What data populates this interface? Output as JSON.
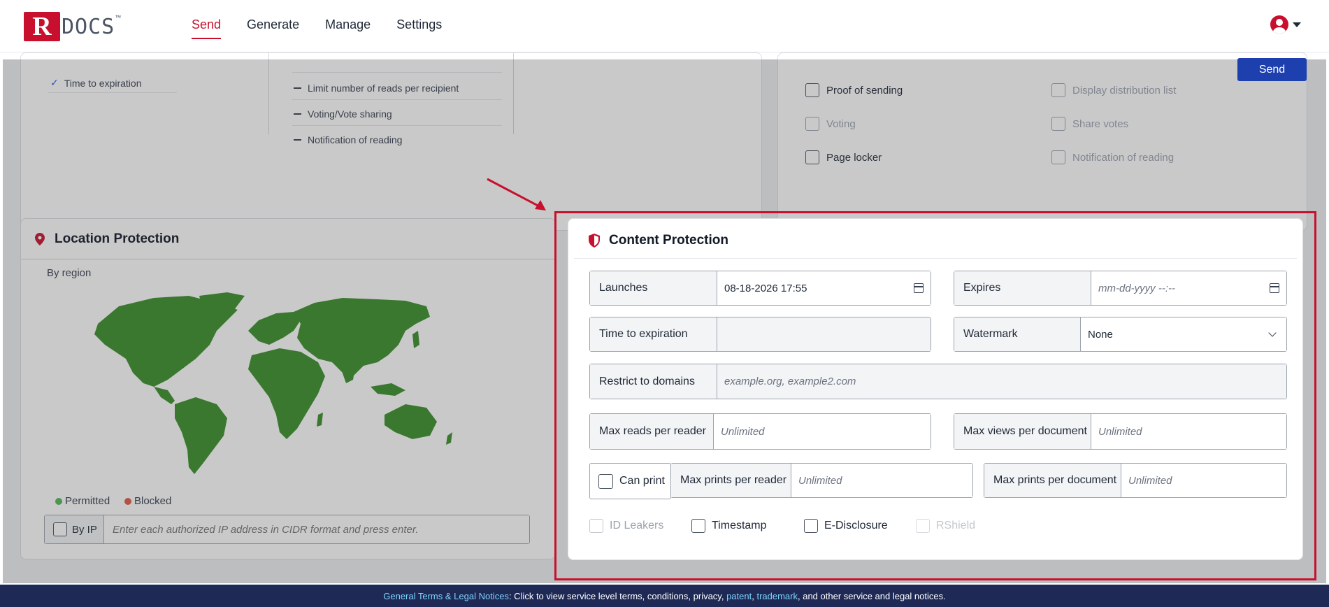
{
  "logo": {
    "letter": "R",
    "text": "DOCS",
    "tm": "™"
  },
  "nav": {
    "items": [
      {
        "label": "Send",
        "active": true
      },
      {
        "label": "Generate",
        "active": false
      },
      {
        "label": "Manage",
        "active": false
      },
      {
        "label": "Settings",
        "active": false
      }
    ]
  },
  "toolbar": {
    "send_label": "Send"
  },
  "features_card": {
    "checked_item": "Time to expiration",
    "items": [
      "Limit number of reads per recipient",
      "Voting/Vote sharing",
      "Notification of reading"
    ]
  },
  "options_card": {
    "left": [
      {
        "label": "Proof of sending",
        "enabled": true
      },
      {
        "label": "Voting",
        "enabled": false
      },
      {
        "label": "Page locker",
        "enabled": true
      }
    ],
    "right": [
      {
        "label": "Display distribution list",
        "enabled": false
      },
      {
        "label": "Share votes",
        "enabled": false
      },
      {
        "label": "Notification of reading",
        "enabled": false
      }
    ]
  },
  "location": {
    "title": "Location Protection",
    "by_region_label": "By region",
    "legend": {
      "permitted": "Permitted",
      "blocked": "Blocked",
      "permitted_color": "#3a8f2a",
      "blocked_color": "#c0504d"
    },
    "ip": {
      "label": "By IP",
      "placeholder": "Enter each authorized IP address in CIDR format and press enter."
    }
  },
  "content": {
    "title": "Content Protection",
    "launches": {
      "label": "Launches",
      "value": "08-18-2026 17:55"
    },
    "expires": {
      "label": "Expires",
      "placeholder": "mm-dd-yyyy --:--"
    },
    "time_to_expiration": {
      "label": "Time to expiration",
      "value": ""
    },
    "watermark": {
      "label": "Watermark",
      "value": "None"
    },
    "restrict_domains": {
      "label": "Restrict to domains",
      "placeholder": "example.org, example2.com"
    },
    "max_reads_reader": {
      "label": "Max reads per reader",
      "placeholder": "Unlimited"
    },
    "max_views_document": {
      "label": "Max views per document",
      "placeholder": "Unlimited"
    },
    "can_print": {
      "label": "Can print"
    },
    "max_prints_reader": {
      "label": "Max prints per reader",
      "placeholder": "Unlimited"
    },
    "max_prints_document": {
      "label": "Max prints per document",
      "placeholder": "Unlimited"
    },
    "bottom_options": [
      {
        "label": "ID Leakers",
        "enabled": false
      },
      {
        "label": "Timestamp",
        "enabled": true
      },
      {
        "label": "E-Disclosure",
        "enabled": true
      },
      {
        "label": "RShield",
        "enabled": false
      }
    ]
  },
  "footer": {
    "terms_link": "General Terms & Legal Notices",
    "text_before": ": Click to view service level terms, conditions, privacy, ",
    "patent_link": "patent",
    "separator": ", ",
    "trademark_link": "trademark",
    "text_after": ", and other service and legal notices."
  },
  "colors": {
    "brand_red": "#c8102e",
    "send_blue": "#1e40af",
    "footer_navy": "#1e2a55"
  }
}
